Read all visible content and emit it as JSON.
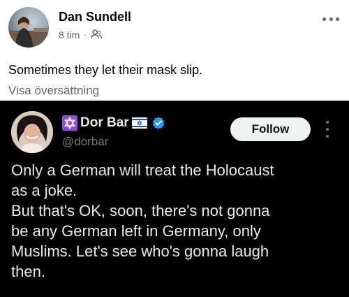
{
  "post": {
    "author": "Dan Sundell",
    "time": "8 tim",
    "separator": "·",
    "audience_icon": "friends-icon",
    "caption": "Sometimes they let their mask slip.",
    "translate_link": "Visa översättning",
    "more_icon": "more-horizontal-icon"
  },
  "embed": {
    "name": "Dor Bar",
    "prefix_icon": "star-of-david-icon",
    "flag_icon": "israel-flag-icon",
    "verified_icon": "verified-badge-icon",
    "handle": "@dorbar",
    "follow_label": "Follow",
    "more_icon": "more-vertical-icon",
    "body_lines": [
      "Only a German will treat the Holocaust",
      "as a joke.",
      "But that's OK, soon, there's not gonna",
      "be any German left in Germany, only",
      "Muslims. Let's see who's gonna laugh",
      "then."
    ]
  },
  "colors": {
    "verified": "#1d9bf0",
    "star_box": "#8e4fd6",
    "embed_bg": "#000000"
  }
}
